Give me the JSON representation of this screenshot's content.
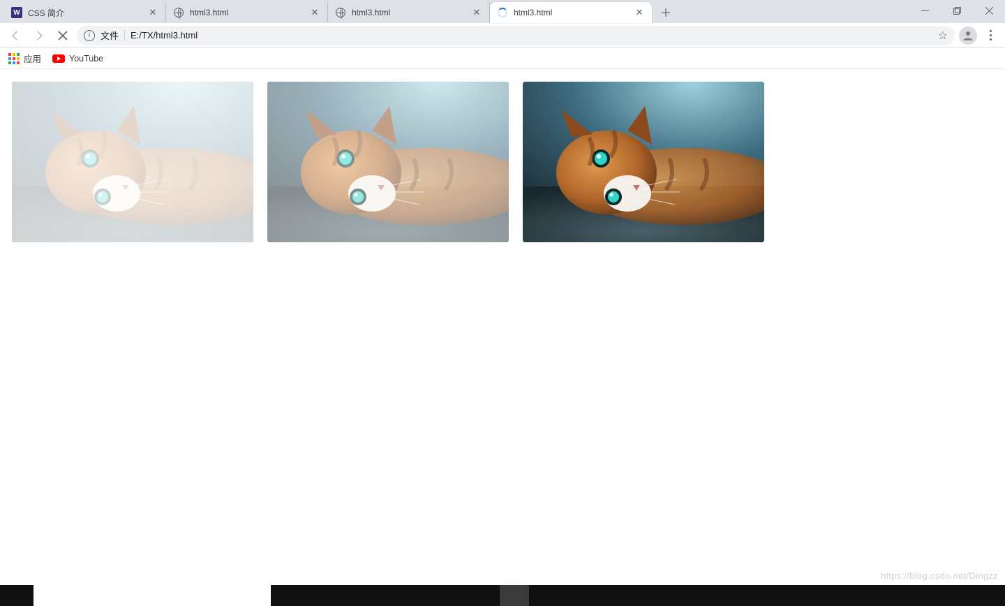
{
  "tabs": [
    {
      "title": "CSS 简介",
      "favicon": "w"
    },
    {
      "title": "html3.html",
      "favicon": "globe"
    },
    {
      "title": "html3.html",
      "favicon": "globe"
    },
    {
      "title": "html3.html",
      "favicon": "spinner",
      "active": true
    }
  ],
  "address": {
    "info_label": "文件",
    "url": "E:/TX/html3.html"
  },
  "bookmarks": {
    "apps": "应用",
    "youtube": "YouTube"
  },
  "images": [
    {
      "opacity_overlay": 0.78
    },
    {
      "opacity_overlay": 0.48
    },
    {
      "opacity_overlay": 0
    }
  ],
  "watermark": "https://blog.csdn.net/Dingzz"
}
